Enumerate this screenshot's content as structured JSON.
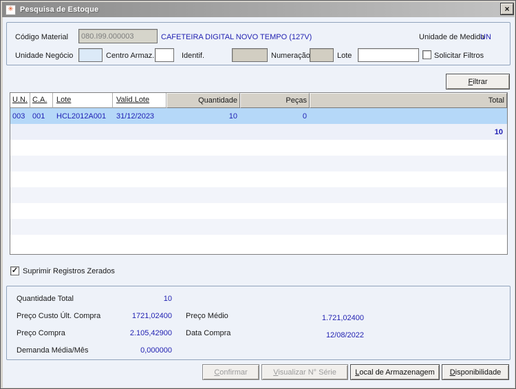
{
  "window": {
    "title": "Pesquisa de Estoque",
    "icon_glyph": "✳",
    "close_glyph": "×"
  },
  "filter_panel": {
    "codigo_material_label": "Código Material",
    "codigo_material_value": "080.I99.000003",
    "material_descricao": "CAFETEIRA DIGITAL NOVO TEMPO (127V)",
    "unidade_medida_label": "Unidade de Medida",
    "unidade_medida_value": "UN",
    "unidade_negocio_label": "Unidade Negócio",
    "centro_armaz_label": "Centro Armaz.",
    "identif_label": "Identif.",
    "numeracao_label": "Numeração",
    "lote_label": "Lote",
    "solicitar_filtros_label": "Solicitar Filtros",
    "solicitar_filtros_checked": false,
    "filtrar_label": "Filtrar"
  },
  "table": {
    "headers": {
      "un": "U.N.",
      "ca": "C.A.",
      "lote": "Lote",
      "valid_lote": "Valid.Lote",
      "quantidade": "Quantidade",
      "pecas": "Peças",
      "total": "Total"
    },
    "rows": [
      {
        "un": "003",
        "ca": "001",
        "lote": "HCL2012A001",
        "valid_lote": "31/12/2023",
        "quantidade": "10",
        "pecas": "0",
        "total": ""
      }
    ],
    "grand_total": "10"
  },
  "options": {
    "suprimir_registros_label": "Suprimir Registros Zerados",
    "suprimir_registros_checked": true,
    "check_glyph": "✓"
  },
  "summary": {
    "quantidade_total_label": "Quantidade Total",
    "quantidade_total_value": "10",
    "preco_custo_label": "Preço Custo Últ. Compra",
    "preco_custo_value": "1721,02400",
    "preco_medio_label": "Preço Médio",
    "preco_medio_value": "1.721,02400",
    "preco_compra_label": "Preço Compra",
    "preco_compra_value": "2.105,42900",
    "data_compra_label": "Data Compra",
    "data_compra_value": "12/08/2022",
    "demanda_label": "Demanda Média/Mês",
    "demanda_value": "0,000000"
  },
  "buttons": {
    "confirmar": "Confirmar",
    "visualizar_serie": "Visualizar N° Série",
    "local_armazenagem": "Local de Armazenagem",
    "disponibilidade": "Disponibilidade"
  },
  "colors": {
    "accent_blue_text": "#2222b2",
    "selected_row_bg": "#b5d8f8",
    "titlebar_start": "#8a8a8a",
    "titlebar_end": "#c3c3c3",
    "client_bg": "#eef2f9",
    "header_gray": "#d5d1c8"
  }
}
